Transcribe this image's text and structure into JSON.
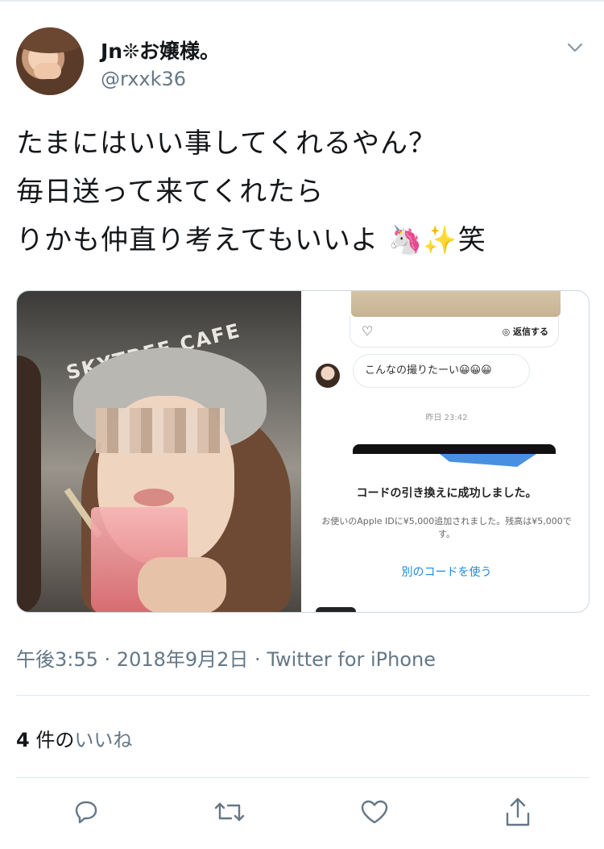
{
  "user": {
    "display_name": "Jn❊お嬢様。",
    "handle": "@rxxk36"
  },
  "tweet": {
    "lines": [
      "たまにはいい事してくれるやん？",
      "毎日送って来てくれたら",
      "りかも仲直り考えてもいいよ 🦄✨笑"
    ]
  },
  "media": {
    "left_sign_text": "SKYTREE CAFE",
    "screenshot": {
      "reply_label": "返信する",
      "bubble_text": "こんなの撮りたーい😀😀😀",
      "time_label": "昨日 23:42",
      "redeem_title": "コードの引き換えに成功しました。",
      "redeem_detail": "お使いのApple IDに¥5,000追加されました。残高は¥5,000です。",
      "other_code_link": "別のコードを使う"
    }
  },
  "meta": {
    "time": "午後3:55",
    "date": "2018年9月2日",
    "client": "Twitter for iPhone",
    "separator": " · "
  },
  "likes": {
    "count": "4",
    "unit": " 件の",
    "label": "いいね"
  },
  "actions": [
    "reply-icon",
    "retweet-icon",
    "like-icon",
    "share-icon"
  ],
  "colors": {
    "secondary_text": "#657786",
    "primary_text": "#14171a",
    "link_blue": "#1d8ae0",
    "icon_color": "#657786"
  }
}
